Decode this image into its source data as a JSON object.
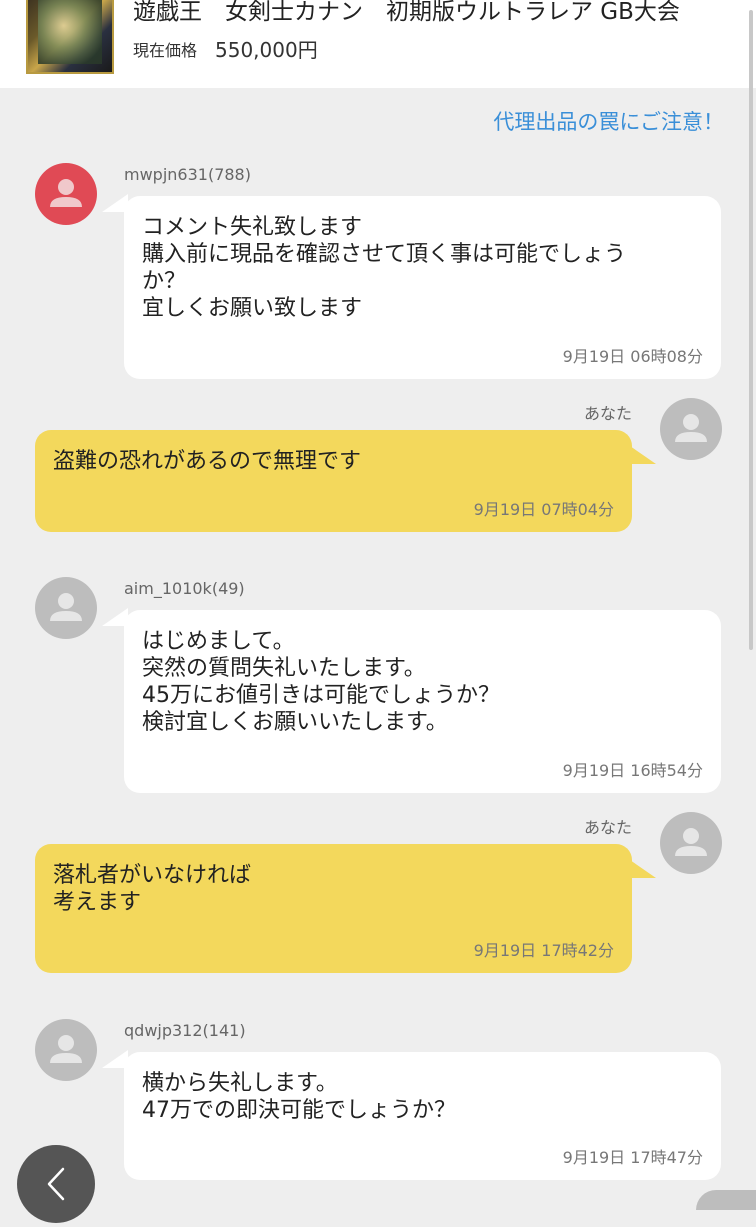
{
  "header": {
    "title": "遊戯王　女剣士カナン　初期版ウルトラレア GB大会",
    "price_label": "現在価格",
    "price_value": "550,000円"
  },
  "notice_link": "代理出品の罠にご注意！",
  "messages": [
    {
      "sender": "mwpjn631(788)",
      "text": "コメント失礼致します\n購入前に現品を確認させて頂く事は可能でしょう\nか？\n宜しくお願い致します",
      "time": "9月19日 06時08分"
    },
    {
      "sender": "あなた",
      "text": "盗難の恐れがあるので無理です",
      "time": "9月19日 07時04分"
    },
    {
      "sender": "aim_1010k(49)",
      "text": "はじめまして。\n突然の質問失礼いたします。\n45万にお値引きは可能でしょうか？\n検討宜しくお願いいたします。",
      "time": "9月19日 16時54分"
    },
    {
      "sender": "あなた",
      "text": "落札者がいなければ\n考えます",
      "time": "9月19日 17時42分"
    },
    {
      "sender": "qdwjp312(141)",
      "text": "横から失礼します。\n47万での即決可能でしょうか？",
      "time": "9月19日 17時47分"
    }
  ],
  "colors": {
    "accent_link": "#3a8fd8",
    "own_bubble": "#f3d85c",
    "other_bubble": "#ffffff",
    "avatar_highlight": "#e04a55"
  },
  "icons": {
    "back": "chevron-left-icon",
    "avatar": "person-icon"
  }
}
